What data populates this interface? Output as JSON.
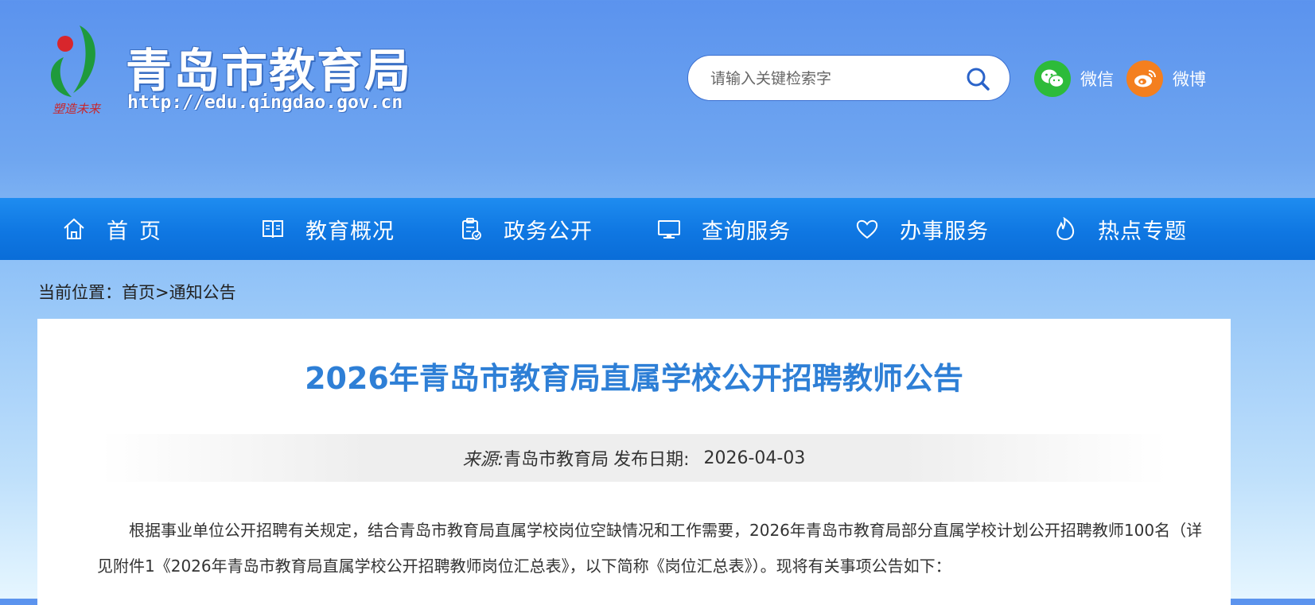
{
  "header": {
    "site_title": "青岛市教育局",
    "site_url": "http://edu.qingdao.gov.cn",
    "logo_slogan": "塑造未来",
    "search_placeholder": "请输入关键检索字",
    "social": {
      "wechat_label": "微信",
      "weibo_label": "微博"
    }
  },
  "nav": {
    "items": [
      {
        "label": "首页",
        "icon": "home-icon"
      },
      {
        "label": "教育概况",
        "icon": "book-icon"
      },
      {
        "label": "政务公开",
        "icon": "clipboard-icon"
      },
      {
        "label": "查询服务",
        "icon": "monitor-icon"
      },
      {
        "label": "办事服务",
        "icon": "heart-icon"
      },
      {
        "label": "热点专题",
        "icon": "flame-icon"
      }
    ]
  },
  "breadcrumb": {
    "prefix": "当前位置：",
    "home": "首页",
    "separator": ">",
    "current": "通知公告"
  },
  "article": {
    "title": "2026年青岛市教育局直属学校公开招聘教师公告",
    "source_label": "来源:",
    "source": "青岛市教育局",
    "date_label": "发布日期:",
    "date": "2026-04-03",
    "paragraph": "根据事业单位公开招聘有关规定，结合青岛市教育局直属学校岗位空缺情况和工作需要，2026年青岛市教育局部分直属学校计划公开招聘教师100名（详见附件1《2026年青岛市教育局直属学校公开招聘教师岗位汇总表》，以下简称《岗位汇总表》）。现将有关事项公告如下："
  },
  "colors": {
    "nav_blue": "#0f77e2",
    "title_blue": "#2e7fd6",
    "wechat_green": "#2dbb3a",
    "weibo_orange": "#f47f1f"
  }
}
